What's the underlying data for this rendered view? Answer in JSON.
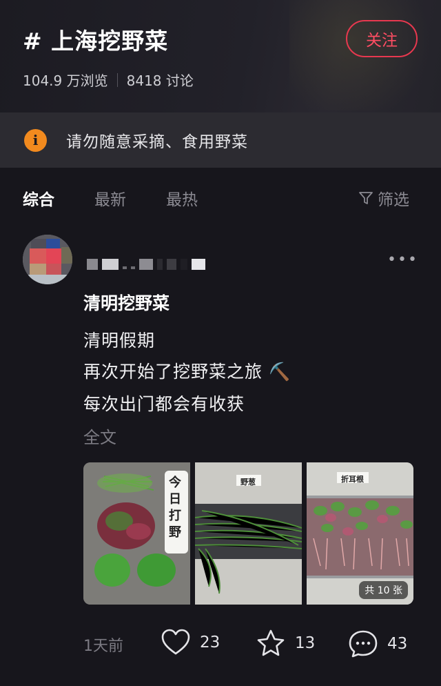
{
  "header": {
    "title": "# 上海挖野菜",
    "follow_label": "关注",
    "views": "104.9 万浏览",
    "discussions": "8418 讨论"
  },
  "notice": {
    "icon": "info-icon",
    "text": "请勿随意采摘、食用野菜"
  },
  "tabs": [
    "综合",
    "最新",
    "最热"
  ],
  "active_tab": "综合",
  "filter_label": "筛选",
  "post": {
    "title": "清明挖野菜",
    "lines": [
      "清明假期",
      "再次开始了挖野菜之旅",
      "每次出门都会有收获"
    ],
    "pickaxe_icon": "⛏️",
    "full_text_label": "全文",
    "images": [
      {
        "overlay": "今日打野"
      },
      {
        "overlay": "野葱"
      },
      {
        "overlay": "折耳根"
      }
    ],
    "image_count_label": "共 10 张",
    "time": "1天前",
    "likes": "23",
    "favorites": "13",
    "comments": "43"
  },
  "colors": {
    "accent": "#e8384f",
    "notice_icon": "#f28a1e",
    "background": "#17161c"
  }
}
